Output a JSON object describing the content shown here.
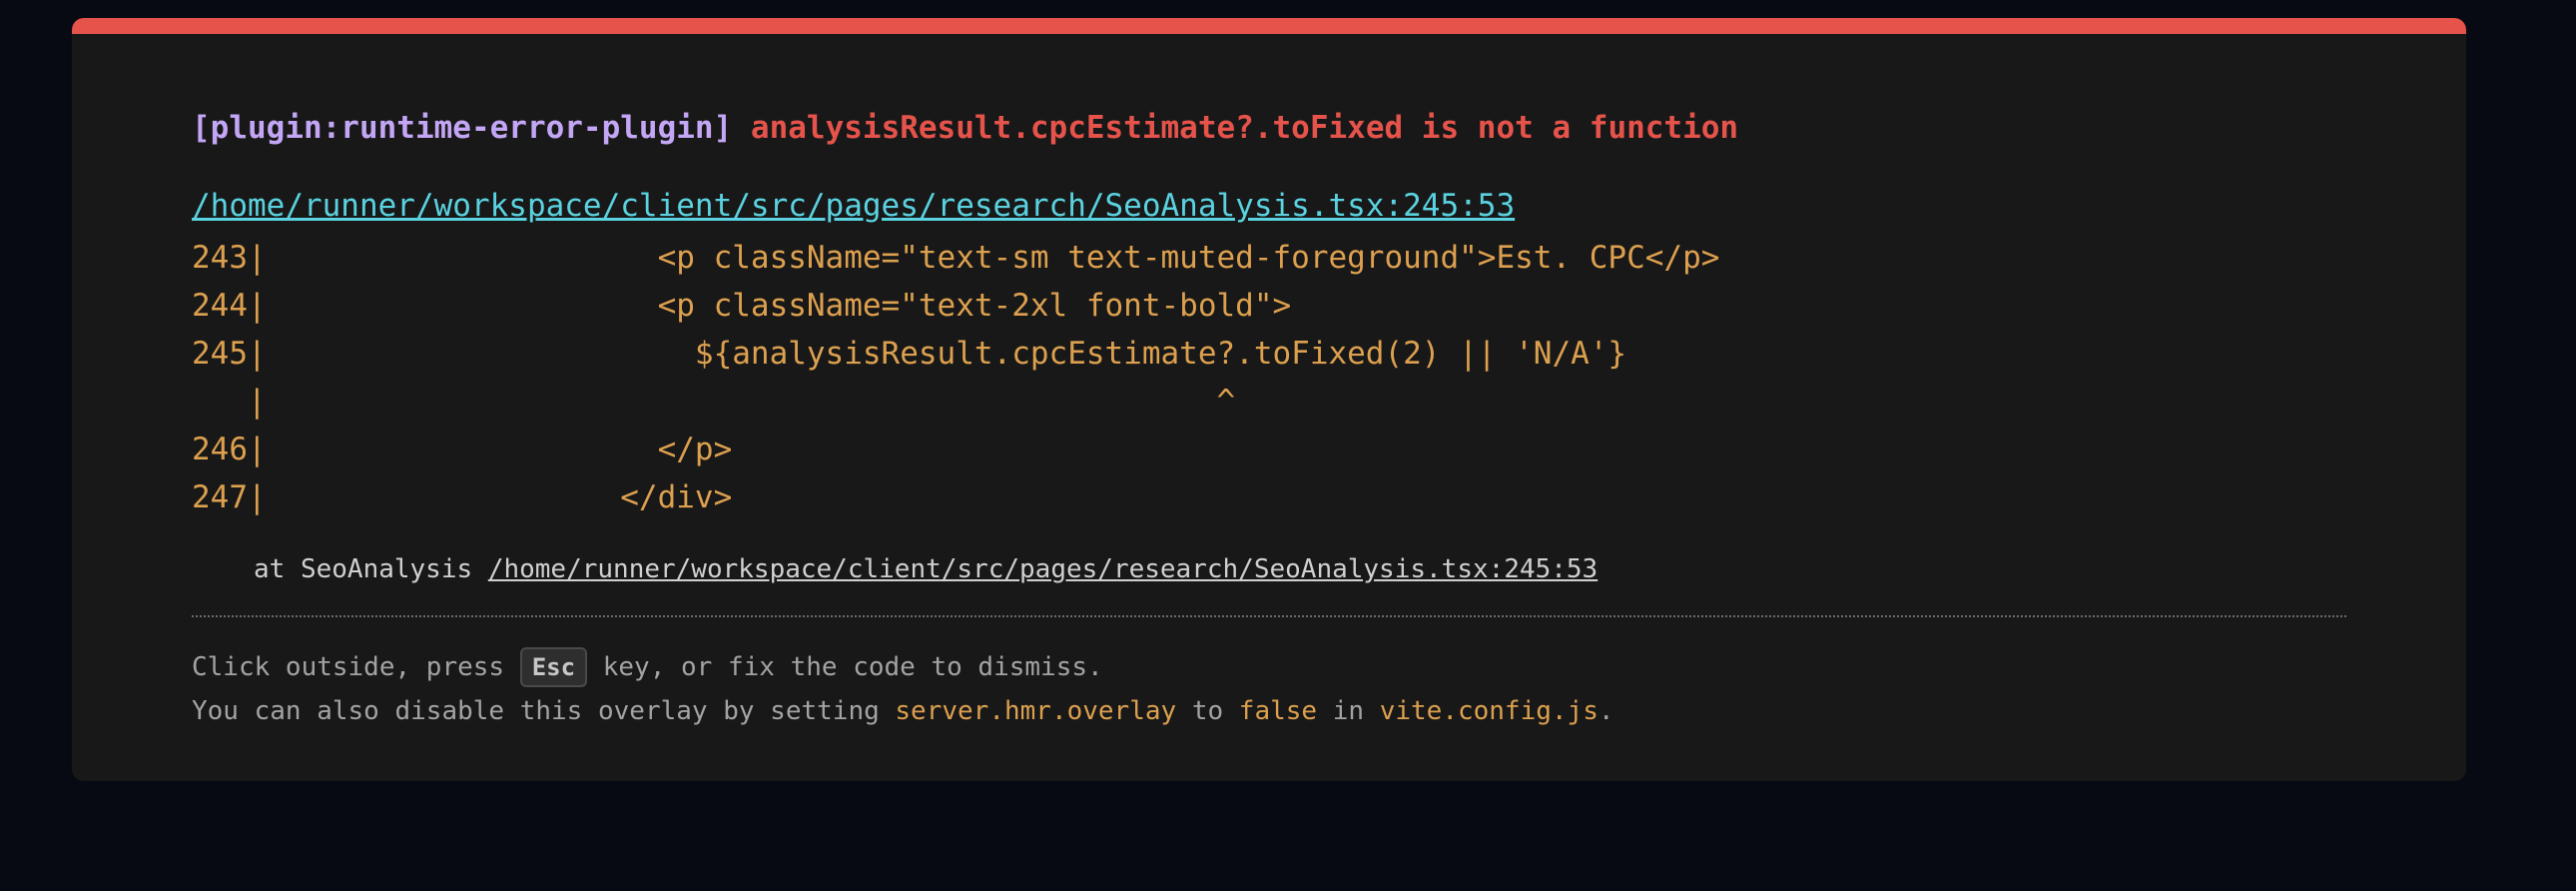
{
  "error": {
    "plugin": "[plugin:runtime-error-plugin]",
    "message": "analysisResult.cpcEstimate?.toFixed is not a function",
    "file": "/home/runner/workspace/client/src/pages/research/SeoAnalysis.tsx:245:53"
  },
  "frame": [
    "243|                     <p className=\"text-sm text-muted-foreground\">Est. CPC</p>",
    "244|                     <p className=\"text-2xl font-bold\">",
    "245|                       ${analysisResult.cpcEstimate?.toFixed(2) || 'N/A'}",
    "   |                                                   ^",
    "246|                     </p>",
    "247|                   </div>"
  ],
  "stack": {
    "prefix": "at SeoAnalysis ",
    "link": "/home/runner/workspace/client/src/pages/research/SeoAnalysis.tsx:245:53"
  },
  "tip": {
    "line1_before": "Click outside, press ",
    "key": "Esc",
    "line1_after": " key, or fix the code to dismiss.",
    "line2_a": "You can also disable this overlay by setting ",
    "line2_setting": "server.hmr.overlay",
    "line2_b": " to ",
    "line2_value": "false",
    "line2_c": " in ",
    "line2_file": "vite.config.js",
    "line2_d": "."
  },
  "colors": {
    "accent_bar": "#e5534b",
    "plugin": "#c3a6f5",
    "message": "#e5534b",
    "link": "#5ad2e0",
    "code": "#dca04f",
    "background": "#181818"
  }
}
